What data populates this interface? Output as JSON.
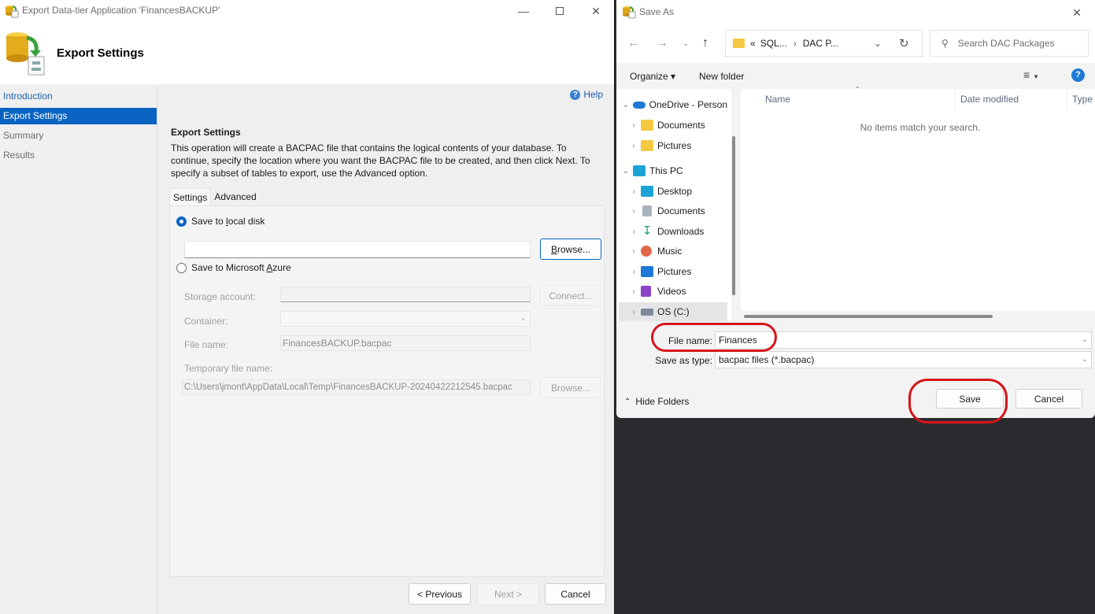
{
  "wizard": {
    "window_title": "Export Data-tier Application 'FinancesBACKUP'",
    "header_title": "Export Settings",
    "nav": [
      {
        "label": "Introduction",
        "state": "link"
      },
      {
        "label": "Export Settings",
        "state": "active"
      },
      {
        "label": "Summary",
        "state": "normal"
      },
      {
        "label": "Results",
        "state": "normal"
      }
    ],
    "help_label": "Help",
    "section_title": "Export Settings",
    "section_description": "This operation will create a BACPAC file that contains the logical contents of your database. To continue, specify the location where you want the BACPAC file to be created, and then click Next. To specify a subset of tables to export, use the Advanced option.",
    "tabs": [
      {
        "label": "Settings",
        "active": true
      },
      {
        "label": "Advanced",
        "active": false
      }
    ],
    "local_disk": {
      "label_pre": "Save to ",
      "label_u": "l",
      "label_post": "ocal disk",
      "selected": true,
      "path_value": "",
      "browse_label_u": "B",
      "browse_label_rest": "rowse..."
    },
    "azure": {
      "label_pre": "Save to Microsoft ",
      "label_u": "A",
      "label_post": "zure",
      "selected": false,
      "storage_account_label": "Storage account:",
      "storage_account_value": "",
      "connect_label": "Connect...",
      "container_label": "Container:",
      "container_value": "",
      "file_name_label": "File name:",
      "file_name_value": "FinancesBACKUP.bacpac",
      "temp_file_label": "Temporary file name:",
      "temp_file_value": "C:\\Users\\jmont\\AppData\\Local\\Temp\\FinancesBACKUP-20240422212545.bacpac",
      "browse_label": "Browse..."
    },
    "footer": {
      "previous_label": "< Previous",
      "next_label": "Next >",
      "cancel_label": "Cancel"
    }
  },
  "save_as": {
    "window_title": "Save As",
    "breadcrumb": {
      "prefix": "«",
      "items": [
        "SQL...",
        "DAC P..."
      ]
    },
    "search_placeholder": "Search DAC Packages",
    "toolbar": {
      "organize_label": "Organize ▾",
      "new_folder_label": "New folder"
    },
    "tree": [
      {
        "label": "OneDrive - Person",
        "icon": "onedrive-icon",
        "expanded": true,
        "level": 0
      },
      {
        "label": "Documents",
        "icon": "folder-icon",
        "expanded": false,
        "level": 1
      },
      {
        "label": "Pictures",
        "icon": "folder-icon",
        "expanded": false,
        "level": 1
      },
      {
        "label": "This PC",
        "icon": "computer-icon",
        "expanded": true,
        "level": 0
      },
      {
        "label": "Desktop",
        "icon": "desktop-icon",
        "expanded": false,
        "level": 1
      },
      {
        "label": "Documents",
        "icon": "documents-icon",
        "expanded": false,
        "level": 1
      },
      {
        "label": "Downloads",
        "icon": "download-icon",
        "expanded": false,
        "level": 1
      },
      {
        "label": "Music",
        "icon": "music-icon",
        "expanded": false,
        "level": 1
      },
      {
        "label": "Pictures",
        "icon": "pictures-icon",
        "expanded": false,
        "level": 1
      },
      {
        "label": "Videos",
        "icon": "videos-icon",
        "expanded": false,
        "level": 1
      },
      {
        "label": "OS (C:)",
        "icon": "drive-icon",
        "expanded": false,
        "level": 1,
        "selected": true
      }
    ],
    "columns": [
      "Name",
      "Date modified",
      "Type"
    ],
    "empty_message": "No items match your search.",
    "file_name_label": "File name:",
    "file_name_value": "Finances",
    "save_type_label": "Save as type:",
    "save_type_value": "bacpac files (*.bacpac)",
    "hide_folders_label": "Hide Folders",
    "save_label": "Save",
    "cancel_label": "Cancel"
  },
  "colors": {
    "accent": "#0a64c2",
    "annotation": "#d7151a",
    "desktop_bg": "#2b2a2f"
  }
}
